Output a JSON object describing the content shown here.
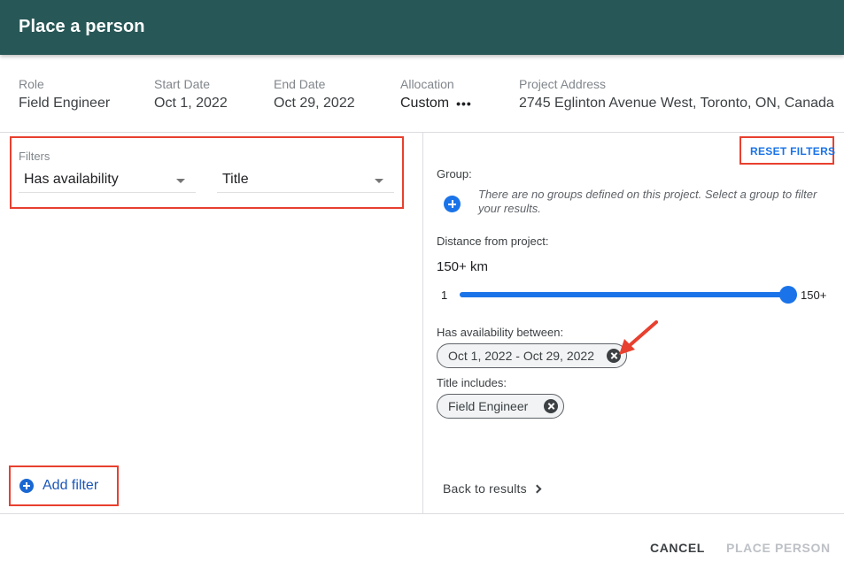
{
  "dialog": {
    "title": "Place a person"
  },
  "info": [
    {
      "label": "Role",
      "value": "Field Engineer"
    },
    {
      "label": "Start Date",
      "value": "Oct 1, 2022"
    },
    {
      "label": "End Date",
      "value": "Oct 29, 2022"
    },
    {
      "label": "Allocation",
      "value": "Custom",
      "more_icon": "more-horizontal-icon"
    },
    {
      "label": "Project Address",
      "value": "2745 Eglinton Avenue West, Toronto, ON, Canada"
    }
  ],
  "filters": {
    "label": "Filters",
    "selects": [
      {
        "value": "Has availability"
      },
      {
        "value": "Title"
      }
    ],
    "add_filter_label": "Add filter",
    "add_filter_icon": "add-circle-icon"
  },
  "right_panel": {
    "reset_label": "RESET FILTERS",
    "group": {
      "label": "Group:",
      "icon": "add-circle-icon",
      "note": "There are no groups defined on this project. Select a group to filter your results."
    },
    "distance": {
      "label": "Distance from project:",
      "value_text": "150+ km",
      "min_label": "1",
      "max_label": "150+",
      "slider_value": 150,
      "slider_min": 1,
      "slider_max": 150
    },
    "availability": {
      "label": "Has availability between:",
      "chip": "Oct 1, 2022 - Oct 29, 2022"
    },
    "title_filter": {
      "label": "Title includes:",
      "chip": "Field Engineer"
    },
    "back_label": "Back to results"
  },
  "footer": {
    "cancel_label": "CANCEL",
    "place_label": "PLACE PERSON"
  },
  "colors": {
    "header": "#285757",
    "accent": "#1a73e8",
    "annotation": "#e8402f"
  }
}
